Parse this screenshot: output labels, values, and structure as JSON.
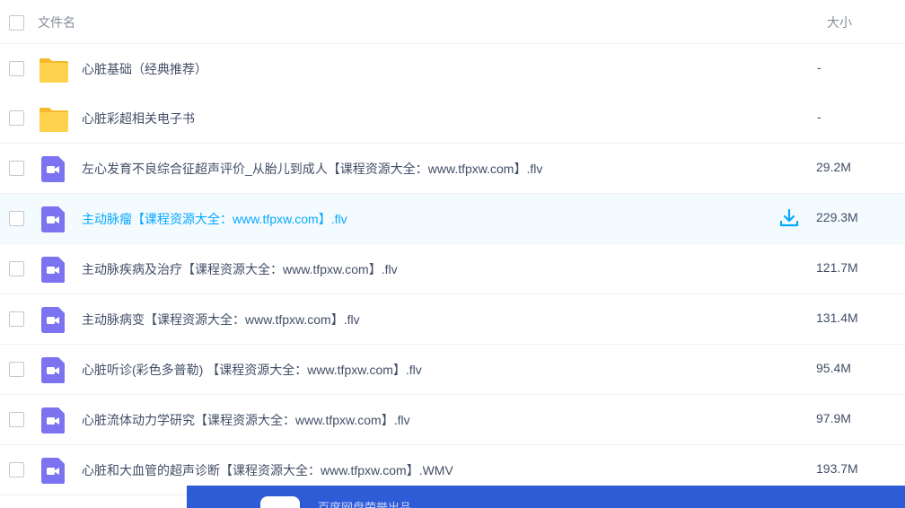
{
  "header": {
    "name_label": "文件名",
    "size_label": "大小"
  },
  "files": [
    {
      "name": "心脏基础（经典推荐）",
      "size": "-",
      "type": "folder-icon"
    },
    {
      "name": "心脏彩超相关电子书",
      "size": "-",
      "type": "folder-icon"
    },
    {
      "name": "左心发育不良综合征超声评价_从胎儿到成人【课程资源大全：www.tfpxw.com】.flv",
      "size": "29.2M",
      "type": "video-file-icon"
    },
    {
      "name": "主动脉瘤【课程资源大全：www.tfpxw.com】.flv",
      "size": "229.3M",
      "type": "video-file-icon",
      "hovered": true
    },
    {
      "name": "主动脉疾病及治疗【课程资源大全：www.tfpxw.com】.flv",
      "size": "121.7M",
      "type": "video-file-icon"
    },
    {
      "name": "主动脉病变【课程资源大全：www.tfpxw.com】.flv",
      "size": "131.4M",
      "type": "video-file-icon"
    },
    {
      "name": "心脏听诊(彩色多普勒) 【课程资源大全：www.tfpxw.com】.flv",
      "size": "95.4M",
      "type": "video-file-icon"
    },
    {
      "name": "心脏流体动力学研究【课程资源大全：www.tfpxw.com】.flv",
      "size": "97.9M",
      "type": "video-file-icon"
    },
    {
      "name": "心脏和大血管的超声诊断【课程资源大全：www.tfpxw.com】.WMV",
      "size": "193.7M",
      "type": "video-file-icon"
    }
  ],
  "banner": {
    "text": "百度网盘荣誉出品"
  },
  "colors": {
    "folder": "#ffd24d",
    "video_icon": "#7b73f0",
    "accent": "#06a7ff",
    "hover_bg": "#f4fbff",
    "banner_bg": "#2e5bd6"
  }
}
